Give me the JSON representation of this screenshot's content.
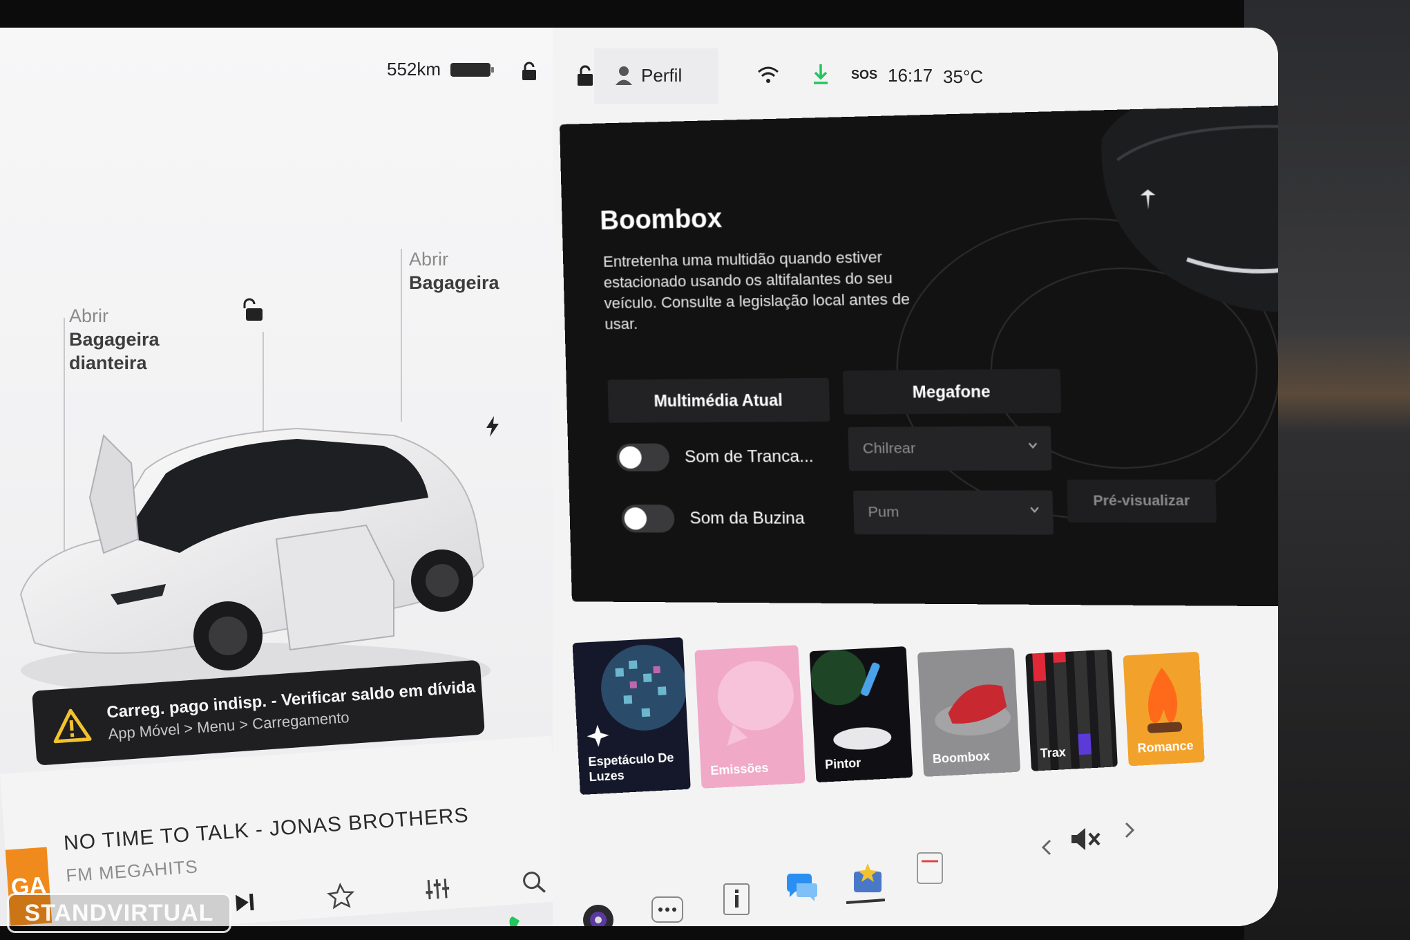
{
  "status": {
    "range": "552km",
    "profile_label": "Perfil",
    "sos_label": "SOS",
    "time": "16:17",
    "temperature": "35°C"
  },
  "vehicle": {
    "frunk_action": "Abrir",
    "frunk_label_1": "Bagageira",
    "frunk_label_2": "dianteira",
    "trunk_action": "Abrir",
    "trunk_label": "Bagageira"
  },
  "alert": {
    "title": "Carreg. pago indisp. - Verificar saldo em dívida",
    "path": "App Móvel > Menu > Carregamento"
  },
  "media": {
    "logo_text": "GA",
    "track": "NO TIME TO TALK - JONAS BROTHERS",
    "station": "FM MEGAHITS"
  },
  "boombox": {
    "title": "Boombox",
    "description": "Entretenha uma multidão quando estiver estacionado usando os altifalantes do seu veículo. Consulte a legislação local antes de usar.",
    "tab_media": "Multimédia Atual",
    "tab_megaphone": "Megafone",
    "lock_sound_label": "Som de Tranca...",
    "lock_sound_value": "Chilrear",
    "horn_sound_label": "Som da Buzina",
    "horn_sound_value": "Pum",
    "preview_label": "Pré-visualizar"
  },
  "apps": [
    {
      "label": "Espetáculo De Luzes",
      "color": "#14182a"
    },
    {
      "label": "Emissões",
      "color": "#f1a9c8"
    },
    {
      "label": "Pintor",
      "color": "#101014"
    },
    {
      "label": "Boombox",
      "color": "#8f8f92"
    },
    {
      "label": "Trax",
      "color": "#1a1a1c"
    },
    {
      "label": "Romance",
      "color": "#f2a22a"
    }
  ],
  "watermark": "STANDVIRTUAL",
  "colors": {
    "accent_green": "#22c55e",
    "alert_yellow": "#f2c230",
    "messages_blue": "#2b8ff2"
  }
}
